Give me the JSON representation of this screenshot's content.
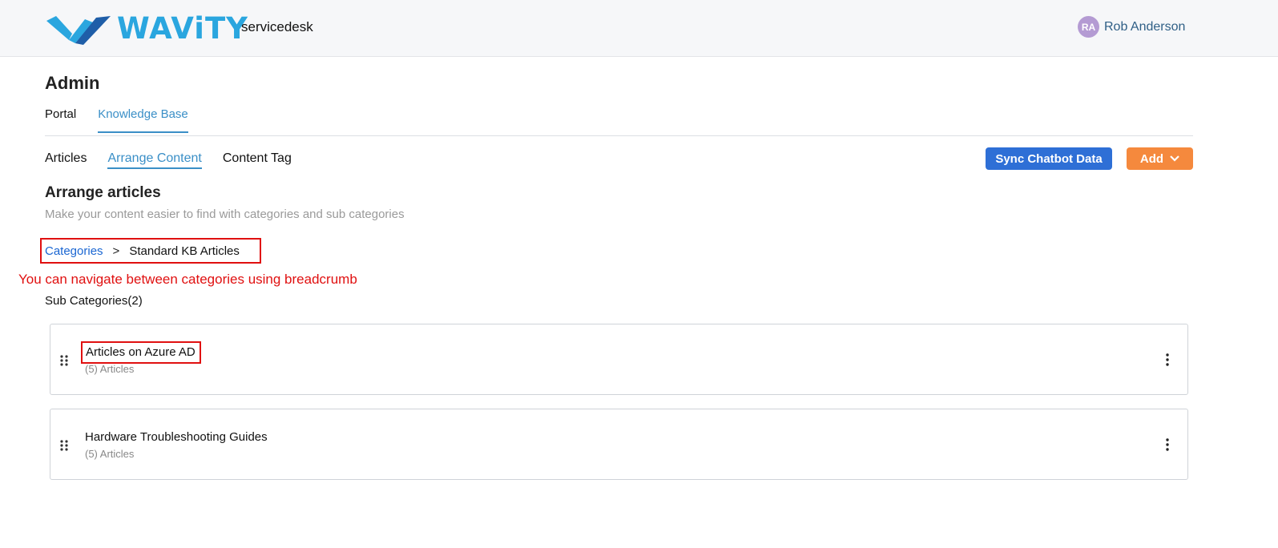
{
  "header": {
    "logo_text": "WAViTY",
    "product_name": "servicedesk",
    "user": {
      "initials": "RA",
      "name": "Rob Anderson"
    },
    "colors": {
      "brand": "#2aa6df",
      "avatar": "#b49bd3"
    }
  },
  "page": {
    "title": "Admin"
  },
  "main_tabs": [
    {
      "label": "Portal",
      "active": false
    },
    {
      "label": "Knowledge Base",
      "active": true
    }
  ],
  "sub_tabs": [
    {
      "label": "Articles",
      "active": false
    },
    {
      "label": "Arrange Content",
      "active": true
    },
    {
      "label": "Content Tag",
      "active": false
    }
  ],
  "actions": {
    "sync_label": "Sync Chatbot Data",
    "add_label": "Add",
    "colors": {
      "sync": "#2e6fd6",
      "add": "#f5893d"
    }
  },
  "section": {
    "title": "Arrange articles",
    "subtitle": "Make your content easier to find with categories and sub categories"
  },
  "breadcrumb": {
    "root": "Categories",
    "separator": ">",
    "current": "Standard KB Articles"
  },
  "annotation": "You can navigate between categories using breadcrumb",
  "subcategories": {
    "count_label": "Sub Categories(2)",
    "items": [
      {
        "title": "Articles on Azure AD",
        "meta": "(5) Articles",
        "icons": [
          "drag-handle-icon",
          "more-vertical-icon"
        ]
      },
      {
        "title": "Hardware Troubleshooting Guides",
        "meta": "(5) Articles",
        "icons": [
          "drag-handle-icon",
          "more-vertical-icon"
        ]
      }
    ]
  }
}
